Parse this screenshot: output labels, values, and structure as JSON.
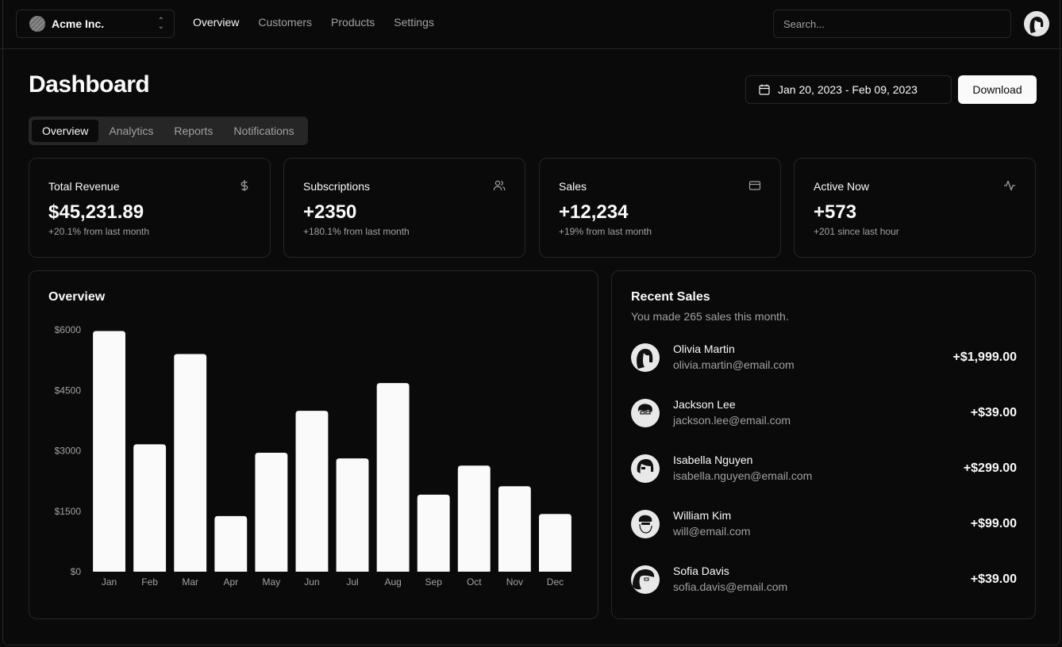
{
  "header": {
    "team": "Acme Inc.",
    "nav": [
      {
        "label": "Overview",
        "active": true
      },
      {
        "label": "Customers",
        "active": false
      },
      {
        "label": "Products",
        "active": false
      },
      {
        "label": "Settings",
        "active": false
      }
    ],
    "search_placeholder": "Search..."
  },
  "page": {
    "title": "Dashboard",
    "date_range": "Jan 20, 2023 - Feb 09, 2023",
    "download_label": "Download",
    "tabs": [
      {
        "label": "Overview",
        "active": true
      },
      {
        "label": "Analytics",
        "active": false
      },
      {
        "label": "Reports",
        "active": false
      },
      {
        "label": "Notifications",
        "active": false
      }
    ]
  },
  "stats": [
    {
      "label": "Total Revenue",
      "value": "$45,231.89",
      "sub": "+20.1% from last month",
      "icon": "dollar-icon"
    },
    {
      "label": "Subscriptions",
      "value": "+2350",
      "sub": "+180.1% from last month",
      "icon": "users-icon"
    },
    {
      "label": "Sales",
      "value": "+12,234",
      "sub": "+19% from last month",
      "icon": "credit-card-icon"
    },
    {
      "label": "Active Now",
      "value": "+573",
      "sub": "+201 since last hour",
      "icon": "activity-icon"
    }
  ],
  "overview": {
    "title": "Overview"
  },
  "chart_data": {
    "type": "bar",
    "title": "Overview",
    "categories": [
      "Jan",
      "Feb",
      "Mar",
      "Apr",
      "May",
      "Jun",
      "Jul",
      "Aug",
      "Sep",
      "Oct",
      "Nov",
      "Dec"
    ],
    "values": [
      5970,
      3160,
      5400,
      1380,
      2950,
      3990,
      2810,
      4680,
      1910,
      2630,
      2120,
      1430
    ],
    "xlabel": "",
    "ylabel": "",
    "ylim": [
      0,
      6000
    ],
    "yticks": [
      0,
      1500,
      3000,
      4500,
      6000
    ],
    "ytick_labels": [
      "$0",
      "$1500",
      "$3000",
      "$4500",
      "$6000"
    ],
    "grid": false,
    "bar_color": "#fafafa"
  },
  "recent_sales": {
    "title": "Recent Sales",
    "description": "You made 265 sales this month.",
    "items": [
      {
        "name": "Olivia Martin",
        "email": "olivia.martin@email.com",
        "amount": "+$1,999.00"
      },
      {
        "name": "Jackson Lee",
        "email": "jackson.lee@email.com",
        "amount": "+$39.00"
      },
      {
        "name": "Isabella Nguyen",
        "email": "isabella.nguyen@email.com",
        "amount": "+$299.00"
      },
      {
        "name": "William Kim",
        "email": "will@email.com",
        "amount": "+$99.00"
      },
      {
        "name": "Sofia Davis",
        "email": "sofia.davis@email.com",
        "amount": "+$39.00"
      }
    ]
  },
  "colors": {
    "background": "#0a0a0a",
    "border": "#262626",
    "muted": "#a1a1a1",
    "foreground": "#fafafa"
  }
}
